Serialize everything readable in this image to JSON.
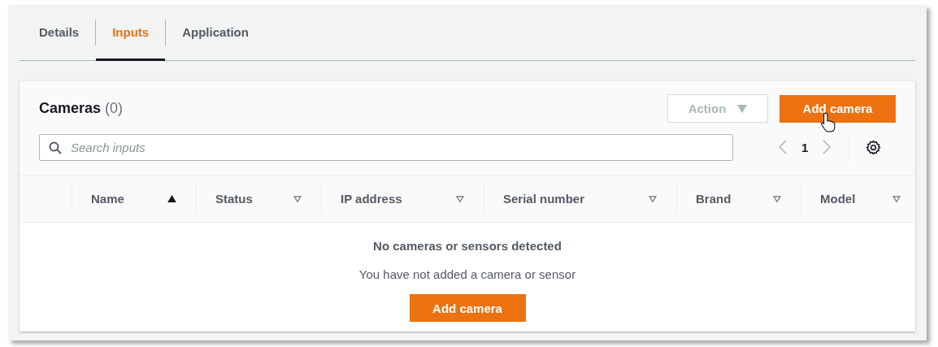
{
  "tabs": [
    {
      "label": "Details",
      "selected": false
    },
    {
      "label": "Inputs",
      "selected": true
    },
    {
      "label": "Application",
      "selected": false
    }
  ],
  "cameras": {
    "title": "Cameras",
    "count": "(0)",
    "action_button": {
      "label": "Action",
      "disabled": true
    },
    "add_button": {
      "label": "Add camera"
    },
    "search": {
      "placeholder": "Search inputs"
    },
    "pagination": {
      "page": "1"
    },
    "table": {
      "columns": [
        {
          "label": "Name",
          "sorted": true
        },
        {
          "label": "Status",
          "sorted": false
        },
        {
          "label": "IP address",
          "sorted": false
        },
        {
          "label": "Serial number",
          "sorted": false
        },
        {
          "label": "Brand",
          "sorted": false
        },
        {
          "label": "Model",
          "sorted": false
        }
      ],
      "empty": {
        "title": "No cameras or sensors detected",
        "message": "You have not added a camera or sensor",
        "button": "Add camera"
      }
    }
  }
}
